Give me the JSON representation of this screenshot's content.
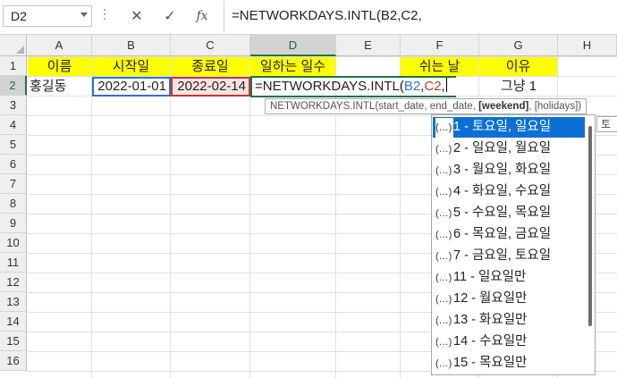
{
  "formula_bar": {
    "name_box": "D2",
    "cancel_icon": "✕",
    "enter_icon": "✓",
    "fx_icon": "fx",
    "formula": "=NETWORKDAYS.INTL(B2,C2,"
  },
  "columns": [
    "A",
    "B",
    "C",
    "D",
    "E",
    "F",
    "G",
    "H"
  ],
  "rows": [
    "1",
    "2",
    "3",
    "4",
    "5",
    "6",
    "7",
    "8",
    "9",
    "10",
    "11",
    "12",
    "13",
    "14",
    "15",
    "16"
  ],
  "cells": {
    "A1": "이름",
    "B1": "시작일",
    "C1": "종료일",
    "D1": "일하는 일수",
    "F1": "쉬는 날",
    "G1": "이유",
    "A2": "홍길동",
    "B2": "2022-01-01",
    "C2": "2022-02-14",
    "D2_prefix": "=NETWORKDAYS.INTL(",
    "D2_ref1": "B2",
    "D2_comma1": ",",
    "D2_ref2": "C2",
    "D2_comma2": ",",
    "G2": "그냥 1"
  },
  "tooltip": {
    "prefix": "NETWORKDAYS.INTL(start_date, end_date, ",
    "current_arg": "[weekend]",
    "suffix": ", [holidays])"
  },
  "side_tip": "토",
  "autocomplete": {
    "item_icon": "(…)",
    "items": [
      "1 - 토요일, 일요일",
      "2 - 일요일, 월요일",
      "3 - 월요일, 화요일",
      "4 - 화요일, 수요일",
      "5 - 수요일, 목요일",
      "6 - 목요일, 금요일",
      "7 - 금요일, 토요일",
      "11 - 일요일만",
      "12 - 월요일만",
      "13 - 화요일만",
      "14 - 수요일만",
      "15 - 목요일만"
    ]
  },
  "colors": {
    "header_fill": "#ffff00",
    "ref_blue": "#2f6fcf",
    "ref_red": "#c0392b",
    "selected_item": "#0a70d6",
    "excel_green": "#217346"
  }
}
